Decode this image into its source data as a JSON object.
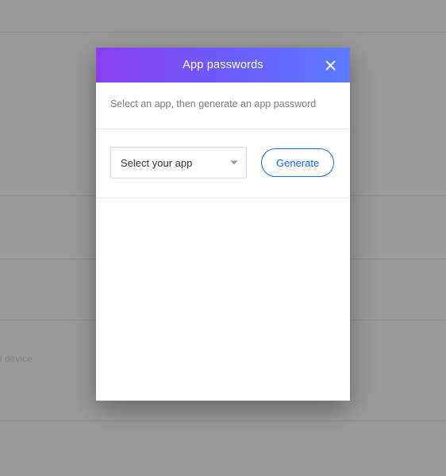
{
  "background": {
    "device_fragment": "l device"
  },
  "modal": {
    "title": "App passwords",
    "instructions": "Select an app, then generate an app password",
    "select": {
      "selected_label": "Select your app"
    },
    "generate_label": "Generate"
  }
}
